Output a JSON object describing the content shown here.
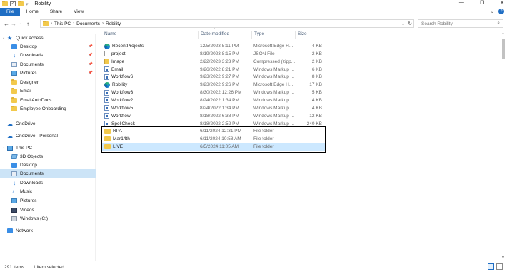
{
  "window": {
    "title": "Robility",
    "controls": [
      "—",
      "❐",
      "✕"
    ]
  },
  "ribbon": {
    "tabs": [
      "File",
      "Home",
      "Share",
      "View"
    ]
  },
  "address": {
    "crumbs": [
      "This PC",
      "Documents",
      "Robility"
    ],
    "search_placeholder": "Search Robility"
  },
  "sidebar": {
    "quick_access": "Quick access",
    "quick_items": [
      "Desktop",
      "Downloads",
      "Documents",
      "Pictures",
      "Designer",
      "Email",
      "EmailAutoDocs",
      "Employee Onboarding"
    ],
    "onedrive": "OneDrive",
    "onedrive_personal": "OneDrive - Personal",
    "this_pc": "This PC",
    "pc_items": [
      "3D Objects",
      "Desktop",
      "Documents",
      "Downloads",
      "Music",
      "Pictures",
      "Videos",
      "Windows (C:)"
    ],
    "network": "Network"
  },
  "columns": {
    "name": "Name",
    "date": "Date modified",
    "type": "Type",
    "size": "Size"
  },
  "files": [
    {
      "name": "RecentProjects",
      "date": "12/5/2023 5:11 PM",
      "type": "Microsoft Edge H...",
      "size": "4 KB",
      "icon": "edge-icon"
    },
    {
      "name": "project",
      "date": "8/19/2023 8:15 PM",
      "type": "JSON File",
      "size": "2 KB",
      "icon": "json-icon"
    },
    {
      "name": "Image",
      "date": "2/22/2023 3:23 PM",
      "type": "Compressed (zipp...",
      "size": "2 KB",
      "icon": "zip-icon"
    },
    {
      "name": "Email",
      "date": "9/26/2022 8:21 PM",
      "type": "Windows Markup ...",
      "size": "6 KB",
      "icon": "xaml-icon"
    },
    {
      "name": "Workflow6",
      "date": "9/23/2022 9:27 PM",
      "type": "Windows Markup ...",
      "size": "8 KB",
      "icon": "xaml-icon"
    },
    {
      "name": "Robility",
      "date": "9/23/2022 9:26 PM",
      "type": "Microsoft Edge H...",
      "size": "17 KB",
      "icon": "edge-icon"
    },
    {
      "name": "Workflow3",
      "date": "8/30/2022 12:26 PM",
      "type": "Windows Markup ...",
      "size": "5 KB",
      "icon": "xaml-icon"
    },
    {
      "name": "Workflow2",
      "date": "8/24/2022 1:34 PM",
      "type": "Windows Markup ...",
      "size": "4 KB",
      "icon": "xaml-icon"
    },
    {
      "name": "Workflow5",
      "date": "8/24/2022 1:34 PM",
      "type": "Windows Markup ...",
      "size": "4 KB",
      "icon": "xaml-icon"
    },
    {
      "name": "Workflow",
      "date": "8/18/2022 6:38 PM",
      "type": "Windows Markup ...",
      "size": "12 KB",
      "icon": "xaml-icon"
    },
    {
      "name": "SpellCheck",
      "date": "8/18/2022 2:52 PM",
      "type": "Windows Markup ...",
      "size": "240 KB",
      "icon": "xaml-icon"
    },
    {
      "name": "RPA",
      "date": "6/11/2024 12:31 PM",
      "type": "File folder",
      "size": "",
      "icon": "folder-icon"
    },
    {
      "name": "Mar14th",
      "date": "6/11/2024 10:58 AM",
      "type": "File folder",
      "size": "",
      "icon": "folder-icon"
    },
    {
      "name": "LIVE",
      "date": "6/5/2024 11:05 AM",
      "type": "File folder",
      "size": "",
      "icon": "folder-icon"
    }
  ],
  "status": {
    "count": "291 items",
    "selected": "1 item selected"
  },
  "colors": {
    "accent": "#1f6ec4",
    "selection": "#cce8ff",
    "folder": "#f2c94c"
  }
}
